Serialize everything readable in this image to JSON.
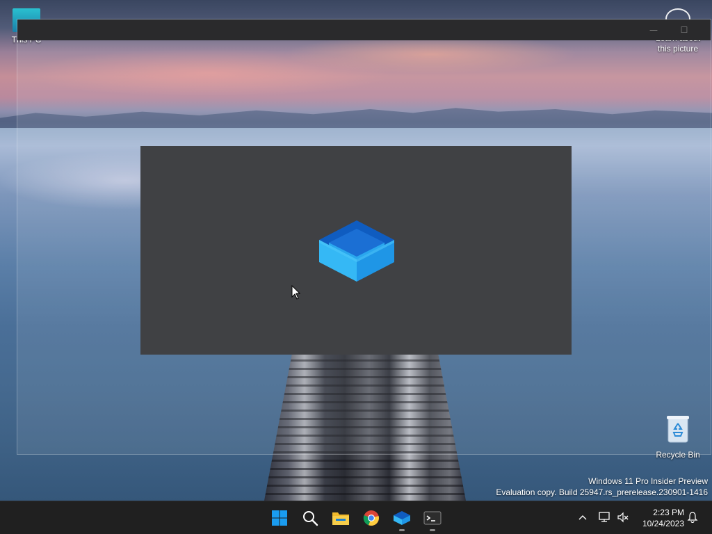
{
  "desktop": {
    "icons": {
      "this_pc": "This PC",
      "learn_about_line1": "Learn about",
      "learn_about_line2": "this picture",
      "recycle_bin": "Recycle Bin"
    }
  },
  "app_window": {
    "minimize_glyph": "—",
    "maximize_glyph": "☐",
    "splash_logo": "box-app-logo-icon"
  },
  "watermark": {
    "line1": "Windows 11 Pro Insider Preview",
    "line2": "Evaluation copy. Build 25947.rs_prerelease.230901-1416"
  },
  "taskbar": {
    "apps": [
      "start-icon",
      "search-icon",
      "file-explorer-icon",
      "chrome-icon",
      "box-app-icon",
      "terminal-icon"
    ],
    "tray": {
      "chevron": "chevron-up-icon",
      "network": "network-icon",
      "volume": "volume-muted-icon",
      "notifications": "bell-icon"
    },
    "clock": {
      "time": "2:23 PM",
      "date": "10/24/2023"
    }
  },
  "colors": {
    "taskbar_bg": "#202020",
    "splash_bg": "#404144",
    "titlebar_bg": "#2a2a2c",
    "accent_blue": "#1e90ff"
  }
}
